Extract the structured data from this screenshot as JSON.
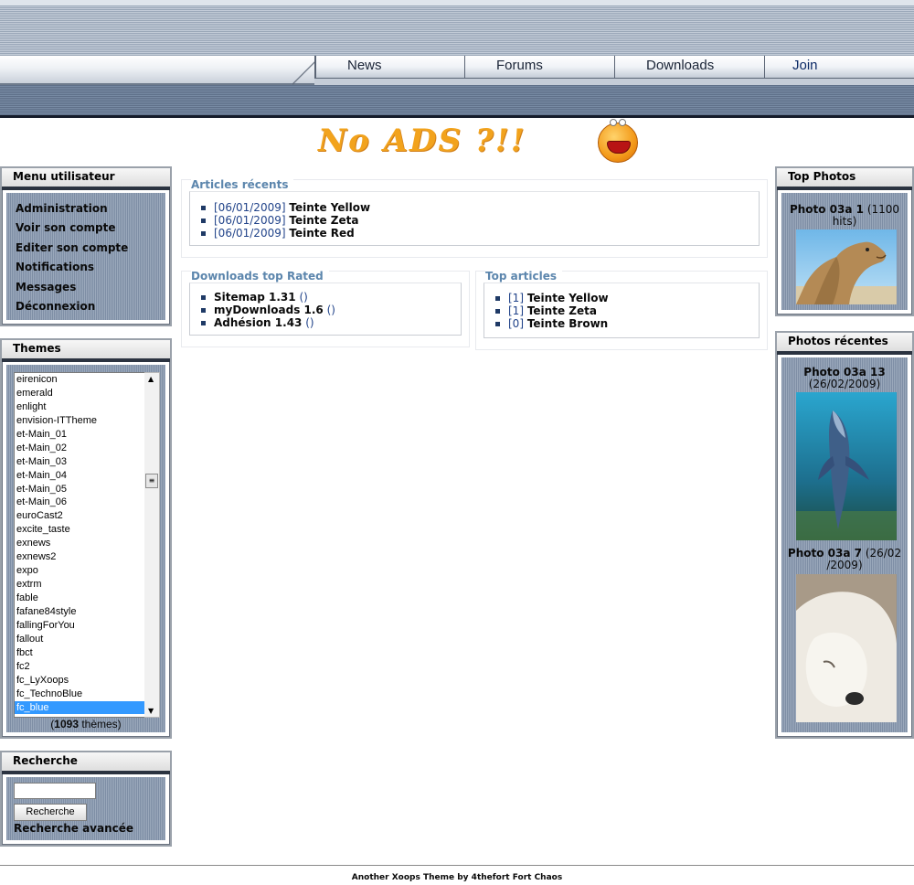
{
  "nav": {
    "items": [
      "News",
      "Forums",
      "Downloads",
      "Join"
    ]
  },
  "banner": {
    "text": "No ADS ?!!"
  },
  "user_menu": {
    "title": "Menu utilisateur",
    "items": [
      "Administration",
      "Voir son compte",
      "Editer son compte",
      "Notifications",
      "Messages",
      "Déconnexion"
    ]
  },
  "themes": {
    "title": "Themes",
    "options": [
      "eirenicon",
      "emerald",
      "enlight",
      "envision-ITTheme",
      "et-Main_01",
      "et-Main_02",
      "et-Main_03",
      "et-Main_04",
      "et-Main_05",
      "et-Main_06",
      "euroCast2",
      "excite_taste",
      "exnews",
      "exnews2",
      "expo",
      "extrm",
      "fable",
      "fafane84style",
      "fallingForYou",
      "fallout",
      "fbct",
      "fc2",
      "fc_LyXoops",
      "fc_TechnoBlue",
      "fc_blue"
    ],
    "selected": "fc_blue",
    "count_open": "(",
    "count": "1093",
    "count_suffix": " thèmes)"
  },
  "search": {
    "title": "Recherche",
    "input_value": "",
    "button": "Recherche",
    "advanced": "Recherche avancée"
  },
  "recent_articles": {
    "title": "Articles récents",
    "items": [
      {
        "date": "[06/01/2009]",
        "title": "Teinte Yellow"
      },
      {
        "date": "[06/01/2009]",
        "title": "Teinte Zeta"
      },
      {
        "date": "[06/01/2009]",
        "title": "Teinte Red"
      }
    ]
  },
  "downloads_top": {
    "title": "Downloads top Rated",
    "items": [
      {
        "name": "Sitemap 1.31",
        "rating": "()"
      },
      {
        "name": "myDownloads 1.6",
        "rating": "()"
      },
      {
        "name": "Adhésion 1.43",
        "rating": "()"
      }
    ]
  },
  "top_articles": {
    "title": "Top articles",
    "items": [
      {
        "count": "[1]",
        "title": "Teinte Yellow"
      },
      {
        "count": "[1]",
        "title": "Teinte Zeta"
      },
      {
        "count": "[0]",
        "title": "Teinte Brown"
      }
    ]
  },
  "top_photos": {
    "title": "Top Photos",
    "photo_name": "Photo 03a 1",
    "photo_hits": " (1100 hits)"
  },
  "recent_photos": {
    "title": "Photos récentes",
    "items": [
      {
        "name": "Photo 03a 13",
        "date": "(26/02/2009)"
      },
      {
        "name": "Photo 03a 7",
        "date": "(26/02 /2009)"
      }
    ]
  },
  "footer": {
    "text": "Another Xoops Theme by 4thefort Fort Chaos"
  },
  "colors": {
    "link": "#22448a",
    "block_title": "#5c86ad",
    "selected": "#3399ff"
  }
}
